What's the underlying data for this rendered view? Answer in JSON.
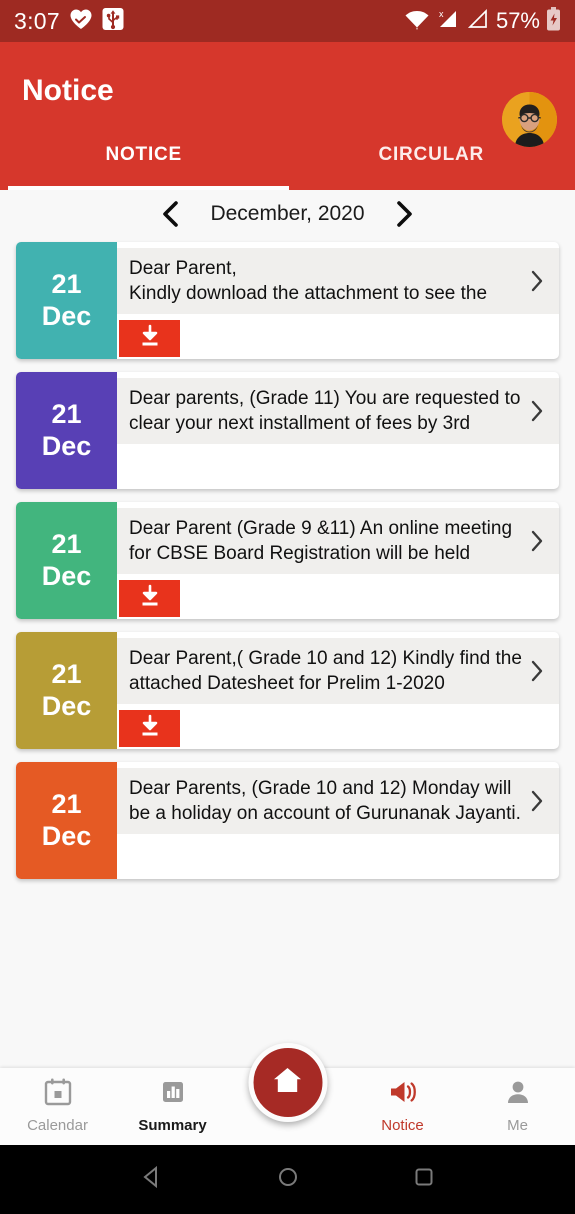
{
  "statusbar": {
    "time": "3:07",
    "battery_percent": "57%",
    "icons": [
      "heart-check-icon",
      "usb-icon",
      "wifi-icon",
      "signal-no-service-icon",
      "signal-icon",
      "battery-icon"
    ],
    "background_color": "#9e2a22"
  },
  "appbar": {
    "title": "Notice",
    "background_color": "#d6372c",
    "avatar_name": "user-avatar"
  },
  "tabs": [
    {
      "label": "NOTICE",
      "active": true
    },
    {
      "label": "CIRCULAR",
      "active": false
    }
  ],
  "month_nav": {
    "prev_icon": "chevron-left-icon",
    "next_icon": "chevron-right-icon",
    "label": "December, 2020"
  },
  "notices": [
    {
      "day": "21",
      "month": "Dec",
      "color": "#41b2b0",
      "message": "Dear Parent,\nKindly download the attachment to see the",
      "has_download": true
    },
    {
      "day": "21",
      "month": "Dec",
      "color": "#5840b5",
      "message": "Dear parents, (Grade 11) You are requested to\nclear your next installment of fees by 3rd",
      "has_download": false
    },
    {
      "day": "21",
      "month": "Dec",
      "color": "#42b57e",
      "message": "Dear Parent (Grade 9 &11) An online meeting\nfor CBSE Board Registration will be held",
      "has_download": true
    },
    {
      "day": "21",
      "month": "Dec",
      "color": "#b79d36",
      "message": "Dear Parent,( Grade 10 and 12) Kindly find the\nattached Datesheet for Prelim 1-2020",
      "has_download": true
    },
    {
      "day": "21",
      "month": "Dec",
      "color": "#e55a24",
      "message": "Dear Parents, (Grade 10 and 12) Monday will\nbe a holiday on account of Gurunanak Jayanti.",
      "has_download": false
    }
  ],
  "download_button": {
    "icon": "download-icon",
    "color": "#e8331c"
  },
  "row_chevron_icon": "chevron-right-icon",
  "bottom_nav": {
    "items": [
      {
        "label": "Calendar",
        "icon": "calendar-icon",
        "active": false,
        "emphasis": "muted"
      },
      {
        "label": "Summary",
        "icon": "bar-chart-icon",
        "active": false,
        "emphasis": "dark"
      },
      {
        "label": "Notice",
        "icon": "megaphone-icon",
        "active": true,
        "emphasis": "active"
      },
      {
        "label": "Me",
        "icon": "person-icon",
        "active": false,
        "emphasis": "muted"
      }
    ],
    "fab": {
      "icon": "home-icon",
      "color": "#a62a25"
    },
    "active_color": "#c0392b"
  },
  "android_nav": {
    "back_icon": "back-triangle-icon",
    "home_icon": "home-circle-icon",
    "recents_icon": "recents-square-icon"
  }
}
